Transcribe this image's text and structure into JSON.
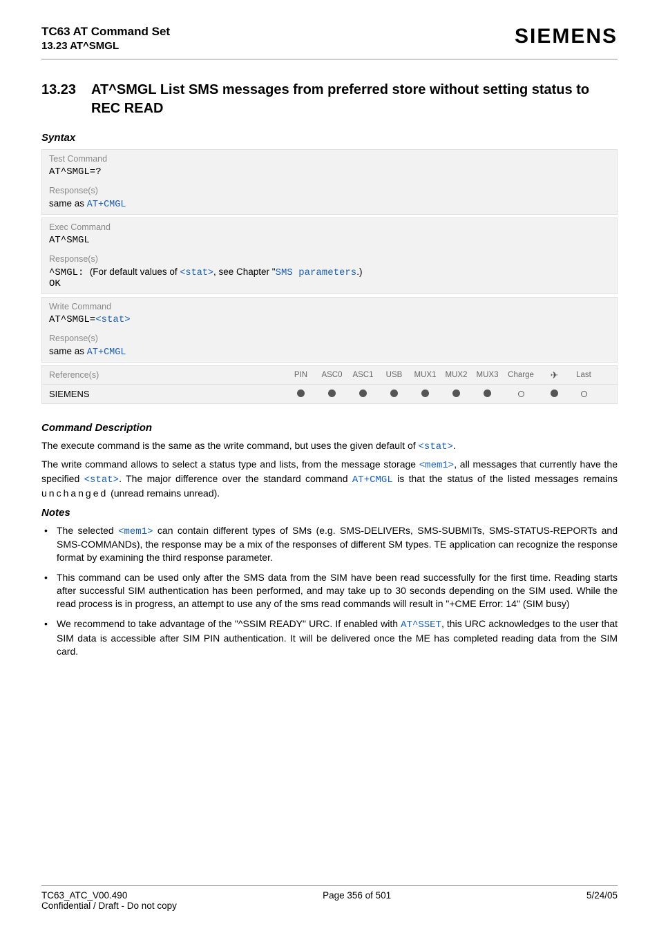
{
  "header": {
    "title": "TC63 AT Command Set",
    "subtitle": "13.23 AT^SMGL",
    "brand": "SIEMENS"
  },
  "section": {
    "number": "13.23",
    "command": "AT^SMGL",
    "title_rest": "   List SMS messages from preferred store without setting status to REC READ"
  },
  "syntax_heading": "Syntax",
  "blocks": {
    "test": {
      "label": "Test Command",
      "cmd": "AT^SMGL=?",
      "resp_label": "Response(s)",
      "resp_prefix": "same as ",
      "resp_link": "AT+CMGL"
    },
    "exec": {
      "label": "Exec Command",
      "cmd": "AT^SMGL",
      "resp_label": "Response(s)",
      "line1_prefix": "^SMGL: ",
      "line1_text1": "(For default values of ",
      "line1_stat": "<stat>",
      "line1_text2": ", see Chapter \"",
      "line1_link": "SMS parameters",
      "line1_text3": ".)",
      "line2": "OK"
    },
    "write": {
      "label": "Write Command",
      "cmd_prefix": "AT^SMGL=",
      "cmd_stat": "<stat>",
      "resp_label": "Response(s)",
      "resp_prefix": "same as ",
      "resp_link": "AT+CMGL"
    },
    "ref": {
      "label": "Reference(s)",
      "value": "SIEMENS",
      "cols": [
        "PIN",
        "ASC0",
        "ASC1",
        "USB",
        "MUX1",
        "MUX2",
        "MUX3",
        "Charge",
        "✈",
        "Last"
      ]
    }
  },
  "desc_heading": "Command Description",
  "desc": {
    "p1_a": "The execute command is the same as the write command, but uses the given default of ",
    "p1_stat": "<stat>",
    "p1_b": ".",
    "p2_a": "The write command allows to select a status type and lists, from the message storage ",
    "p2_mem1": "<mem1>",
    "p2_b": ", all messages that currently have the specified ",
    "p2_stat": "<stat>",
    "p2_c": ". The major difference over the standard command ",
    "p2_link": "AT+CMGL",
    "p2_d": " is that the status of the listed messages remains ",
    "p2_unchanged": "unchanged",
    "p2_e": " (unread remains unread)."
  },
  "notes_heading": "Notes",
  "notes": {
    "n1_a": "The selected ",
    "n1_mem1": "<mem1>",
    "n1_b": " can contain different types of SMs (e.g. SMS-DELIVERs, SMS-SUBMITs, SMS-STATUS-REPORTs and SMS-COMMANDs), the response may be a mix of the responses of different SM types. TE application can recognize the response format by examining the third response parameter.",
    "n2": "This command can be used only after the SMS data from the SIM have been read successfully for the first time. Reading starts after successful SIM authentication has been performed, and may take up to 30 seconds depending on the SIM used. While the read process is in progress, an attempt to use any of the sms read commands will result in \"+CME Error: 14\" (SIM busy)",
    "n3_a": "We recommend to take advantage of the \"^SSIM READY\" URC. If enabled with ",
    "n3_link": "AT^SSET",
    "n3_b": ", this URC acknowledges to the user that SIM data is accessible after SIM PIN authentication. It will be delivered once the ME has completed reading data from the SIM card."
  },
  "footer": {
    "left": "TC63_ATC_V00.490",
    "center": "Page 356 of 501",
    "right": "5/24/05",
    "conf": "Confidential / Draft - Do not copy"
  }
}
